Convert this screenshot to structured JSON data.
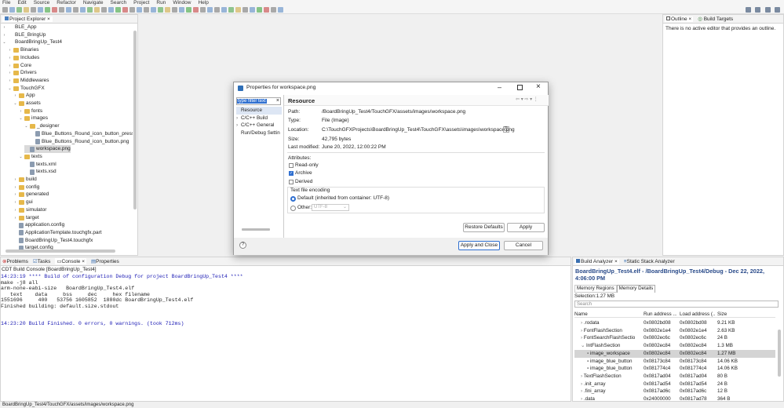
{
  "menu": [
    "File",
    "Edit",
    "Source",
    "Refactor",
    "Navigate",
    "Search",
    "Project",
    "Run",
    "Window",
    "Help"
  ],
  "project_explorer": {
    "title": "Project Explorer",
    "items": [
      {
        "label": "BLE_App",
        "type": "project",
        "twisty": "›"
      },
      {
        "label": "BLE_BringUp",
        "type": "project",
        "twisty": "›"
      },
      {
        "label": "BoardBringUp_Test4",
        "type": "project",
        "twisty": "⌄"
      },
      {
        "label": "Binaries",
        "type": "folder",
        "twisty": "›"
      },
      {
        "label": "Includes",
        "type": "folder",
        "twisty": "›"
      },
      {
        "label": "Core",
        "type": "folder",
        "twisty": "›"
      },
      {
        "label": "Drivers",
        "type": "folder",
        "twisty": "›"
      },
      {
        "label": "Middlewares",
        "type": "folder",
        "twisty": "›"
      },
      {
        "label": "TouchGFX",
        "type": "folder",
        "twisty": "⌄"
      },
      {
        "label": "App",
        "type": "folder",
        "twisty": "›"
      },
      {
        "label": "assets",
        "type": "folder",
        "twisty": "⌄"
      },
      {
        "label": "fonts",
        "type": "folder",
        "twisty": "›"
      },
      {
        "label": "images",
        "type": "folder",
        "twisty": "⌄"
      },
      {
        "label": "_designer",
        "type": "folder",
        "twisty": "⌄"
      },
      {
        "label": "Blue_Buttons_Round_icon_button_presse",
        "type": "file",
        "twisty": ""
      },
      {
        "label": "Blue_Buttons_Round_icon_button.png",
        "type": "file",
        "twisty": ""
      },
      {
        "label": "workspace.png",
        "type": "file",
        "twisty": "",
        "selected": true
      },
      {
        "label": "texts",
        "type": "folder",
        "twisty": "⌄"
      },
      {
        "label": "texts.xml",
        "type": "file",
        "twisty": ""
      },
      {
        "label": "texts.xsd",
        "type": "file",
        "twisty": ""
      },
      {
        "label": "build",
        "type": "folder",
        "twisty": "›"
      },
      {
        "label": "config",
        "type": "folder",
        "twisty": "›"
      },
      {
        "label": "generated",
        "type": "folder",
        "twisty": "›"
      },
      {
        "label": "gui",
        "type": "folder",
        "twisty": "›"
      },
      {
        "label": "simulator",
        "type": "folder",
        "twisty": "›"
      },
      {
        "label": "target",
        "type": "folder",
        "twisty": "›"
      },
      {
        "label": "application.config",
        "type": "file",
        "twisty": ""
      },
      {
        "label": "ApplicationTemplate.touchgfx.part",
        "type": "file",
        "twisty": ""
      },
      {
        "label": "BoardBringUp_Test4.touchgfx",
        "type": "file",
        "twisty": ""
      },
      {
        "label": "target.config",
        "type": "file",
        "twisty": ""
      }
    ]
  },
  "outline": {
    "tabs": [
      "Outline",
      "Build Targets"
    ],
    "message": "There is no active editor that provides an outline."
  },
  "console": {
    "tabs": [
      "Problems",
      "Tasks",
      "Console",
      "Properties"
    ],
    "title": "CDT Build Console [BoardBringUp_Test4]",
    "lines": [
      {
        "text": "14:23:19 **** Build of configuration Debug for project BoardBringUp_Test4 ****",
        "color": "#1a1ab4"
      },
      {
        "text": "make -j8 all",
        "color": "#222"
      },
      {
        "text": "arm-none-eabi-size   BoardBringUp_Test4.elf",
        "color": "#222"
      },
      {
        "text": "   text    data     bss     dec     hex filename",
        "color": "#222"
      },
      {
        "text": "1551696     400   53756 1605852  1880dc BoardBringUp_Test4.elf",
        "color": "#222"
      },
      {
        "text": "Finished building: default.size.stdout",
        "color": "#222"
      },
      {
        "text": "",
        "color": "#222"
      },
      {
        "text": "",
        "color": "#222"
      },
      {
        "text": "14:23:20 Build Finished. 0 errors, 0 warnings. (took 712ms)",
        "color": "#1a1ab4"
      }
    ]
  },
  "status_bar": "BoardBringUp_Test4/TouchGFX/assets/images/workspace.png",
  "dialog": {
    "title": "Properties for workspace.png",
    "filter_placeholder": "type filter text",
    "nav": [
      {
        "label": "Resource",
        "twisty": "",
        "selected": true
      },
      {
        "label": "C/C++ Build",
        "twisty": "›"
      },
      {
        "label": "C/C++ General",
        "twisty": "›"
      },
      {
        "label": "Run/Debug Settin",
        "twisty": ""
      }
    ],
    "heading": "Resource",
    "path_label": "Path:",
    "path_value": "/BoardBringUp_Test4/TouchGFX/assets/images/workspace.png",
    "type_label": "Type:",
    "type_value": "File  (Image)",
    "location_label": "Location:",
    "location_value": "C:\\TouchGFXProjects\\BoardBringUp_Test4\\TouchGFX\\assets\\images\\workspace.png",
    "size_label": "Size:",
    "size_value": "42,795  bytes",
    "modified_label": "Last modified:",
    "modified_value": "June 20, 2022, 12:00:22 PM",
    "attributes_label": "Attributes:",
    "readonly": "Read-only",
    "archive": "Archive",
    "derived": "Derived",
    "encoding_label": "Text file encoding",
    "default_encoding": "Default (inherited from container: UTF-8)",
    "other_label": "Other:",
    "other_value": "UTF-8",
    "restore_defaults": "Restore Defaults",
    "apply": "Apply",
    "apply_close": "Apply and Close",
    "cancel": "Cancel",
    "help": "?"
  },
  "build_analyzer": {
    "tabs": [
      "Build Analyzer",
      "Static Stack Analyzer"
    ],
    "title": "BoardBringUp_Test4.elf - /BoardBringUp_Test4/Debug - Dec 22, 2022, 4:06:00 PM",
    "subtabs": [
      "Memory Regions",
      "Memory Details"
    ],
    "selection": "Selection:1.27 MB",
    "search_placeholder": "Search",
    "columns": [
      "Name",
      "Run address ...",
      "Load address (...",
      "Size"
    ],
    "rows": [
      {
        "name": ".rodata",
        "run": "0x0802bd08",
        "load": "0x0802bd08",
        "size": "9.21 KB",
        "indent": 1,
        "twisty": "›"
      },
      {
        "name": "FontFlashSection",
        "run": "0x0802e1e4",
        "load": "0x0802e1e4",
        "size": "2.63 KB",
        "indent": 1,
        "twisty": "›"
      },
      {
        "name": "FontSearchFlashSectio",
        "run": "0x0802ec6c",
        "load": "0x0802ec6c",
        "size": "24 B",
        "indent": 1,
        "twisty": "›"
      },
      {
        "name": "IntFlashSection",
        "run": "0x0802ec84",
        "load": "0x0802ec84",
        "size": "1.3 MB",
        "indent": 1,
        "twisty": "⌄"
      },
      {
        "name": "image_workspace",
        "run": "0x0802ec84",
        "load": "0x0802ec84",
        "size": "1.27 MB",
        "indent": 2,
        "twisty": "▪",
        "selected": true
      },
      {
        "name": "image_blue_button",
        "run": "0x08173c84",
        "load": "0x08173c84",
        "size": "14.06 KB",
        "indent": 2,
        "twisty": "▪"
      },
      {
        "name": "image_blue_button",
        "run": "0x081774c4",
        "load": "0x081774c4",
        "size": "14.06 KB",
        "indent": 2,
        "twisty": "▪"
      },
      {
        "name": "TextFlashSection",
        "run": "0x0817ad04",
        "load": "0x0817ad04",
        "size": "80 B",
        "indent": 1,
        "twisty": "›"
      },
      {
        "name": ".init_array",
        "run": "0x0817ad54",
        "load": "0x0817ad54",
        "size": "24 B",
        "indent": 1,
        "twisty": "›"
      },
      {
        "name": ".fini_array",
        "run": "0x0817ad6c",
        "load": "0x0817ad6c",
        "size": "12 B",
        "indent": 1,
        "twisty": "›"
      },
      {
        "name": ".data",
        "run": "0x24000000",
        "load": "0x0817ad78",
        "size": "364 B",
        "indent": 1,
        "twisty": "›"
      }
    ]
  }
}
